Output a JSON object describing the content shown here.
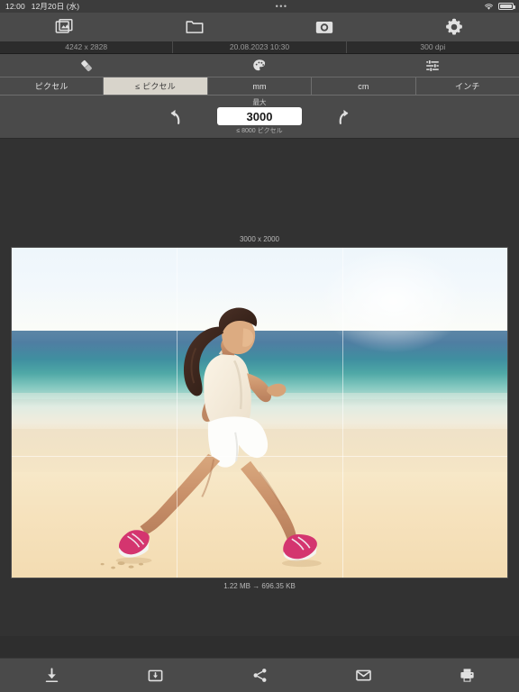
{
  "status_bar": {
    "time": "12:00",
    "date": "12月20日 (水)",
    "center_dots": "•••",
    "wifi_icon": "wifi-icon",
    "battery_icon": "battery-icon"
  },
  "top_nav": {
    "items": [
      {
        "name": "photos-library",
        "icon": "photo-stack-icon"
      },
      {
        "name": "files-browser",
        "icon": "folder-icon"
      },
      {
        "name": "camera",
        "icon": "camera-icon"
      },
      {
        "name": "settings",
        "icon": "gear-icon"
      }
    ]
  },
  "info_row": {
    "dimensions": "4242 x 2828",
    "datetime": "20.08.2023 10:30",
    "resolution": "300 dpi"
  },
  "tool_row": {
    "items": [
      {
        "name": "eraser-tool",
        "icon": "eraser-icon"
      },
      {
        "name": "palette-tool",
        "icon": "palette-icon"
      },
      {
        "name": "adjustments-tool",
        "icon": "sliders-icon"
      }
    ]
  },
  "unit_tabs": {
    "selected_index": 1,
    "tabs": [
      {
        "label": "ピクセル",
        "name": "tab-pixel"
      },
      {
        "label": "≤ ピクセル",
        "name": "tab-max-pixel"
      },
      {
        "label": "mm",
        "name": "tab-mm"
      },
      {
        "label": "cm",
        "name": "tab-cm"
      },
      {
        "label": "インチ",
        "name": "tab-inch"
      }
    ]
  },
  "size_control": {
    "label": "最大",
    "value": "3000",
    "hint": "≤ 8000 ピクセル",
    "undo_icon": "undo-arrow-icon",
    "redo_icon": "redo-arrow-icon"
  },
  "canvas": {
    "output_dimensions": "3000 x 2000",
    "file_size": "1.22 MB  →  696.35 KB",
    "image_description": "woman jogging on a beach",
    "guides": "rule-of-thirds"
  },
  "bottom_bar": {
    "items": [
      {
        "name": "download-button",
        "icon": "download-icon"
      },
      {
        "name": "save-to-folder-button",
        "icon": "folder-download-icon"
      },
      {
        "name": "share-button",
        "icon": "share-icon"
      },
      {
        "name": "email-button",
        "icon": "envelope-icon"
      },
      {
        "name": "print-button",
        "icon": "printer-icon"
      }
    ]
  },
  "colors": {
    "chrome": "#4a4a4a",
    "canvas_bg": "#323232",
    "statusbar_bg": "#3c3c3c",
    "active_tab": "#d8d4cb",
    "icon": "#e0e0e0"
  }
}
